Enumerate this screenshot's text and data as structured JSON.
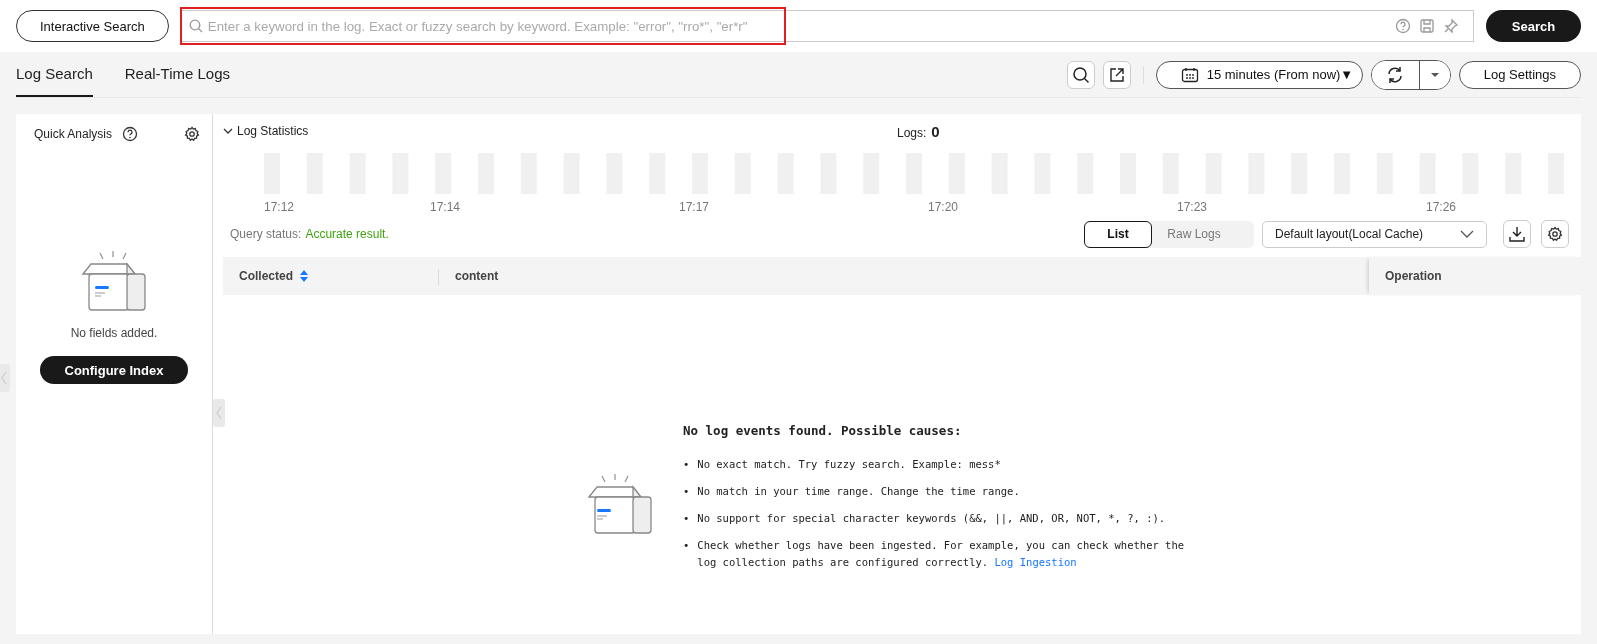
{
  "topbar": {
    "mode_button": "Interactive Search",
    "search": {
      "placeholder": "Enter a keyword in the log. Exact or fuzzy search by keyword. Example: \"error\", \"rro*\", \"er*r\"",
      "highlighted": true
    },
    "search_button": "Search"
  },
  "tabs": [
    {
      "label": "Log Search",
      "selected": true
    },
    {
      "label": "Real-Time Logs",
      "selected": false
    }
  ],
  "toolbar": {
    "time_range": "15 minutes (From now)▼",
    "settings_button": "Log Settings"
  },
  "quick_analysis": {
    "title": "Quick Analysis",
    "empty_text": "No fields added.",
    "button": "Configure Index"
  },
  "statistics": {
    "title": "Log Statistics",
    "expanded": true,
    "logs_label": "Logs:",
    "logs_count": "0",
    "time_labels": [
      "17:12",
      "17:14",
      "17:17",
      "17:20",
      "17:23",
      "17:26"
    ]
  },
  "query_status": {
    "label": "Query status:",
    "value": "Accurate result."
  },
  "view_toggle": [
    {
      "label": "List",
      "selected": true
    },
    {
      "label": "Raw Logs",
      "selected": false
    }
  ],
  "layout_select": "Default layout(Local Cache)",
  "table": {
    "columns": [
      "Collected",
      "content",
      "Operation"
    ]
  },
  "empty_state": {
    "title": "No log events found. Possible causes:",
    "causes": [
      {
        "bullet": "•",
        "text": "No exact match. Try fuzzy search. Example: mess*"
      },
      {
        "bullet": "•",
        "text": "No match in your time range. Change the time range."
      },
      {
        "bullet": "•",
        "text": "No support for special character keywords (&&, ||, AND, OR, NOT, *, ?, :)."
      },
      {
        "bullet": "•",
        "text": "Check whether logs have been ingested. For example, you can check whether the log collection paths are configured correctly.",
        "link": "Log Ingestion"
      }
    ]
  }
}
